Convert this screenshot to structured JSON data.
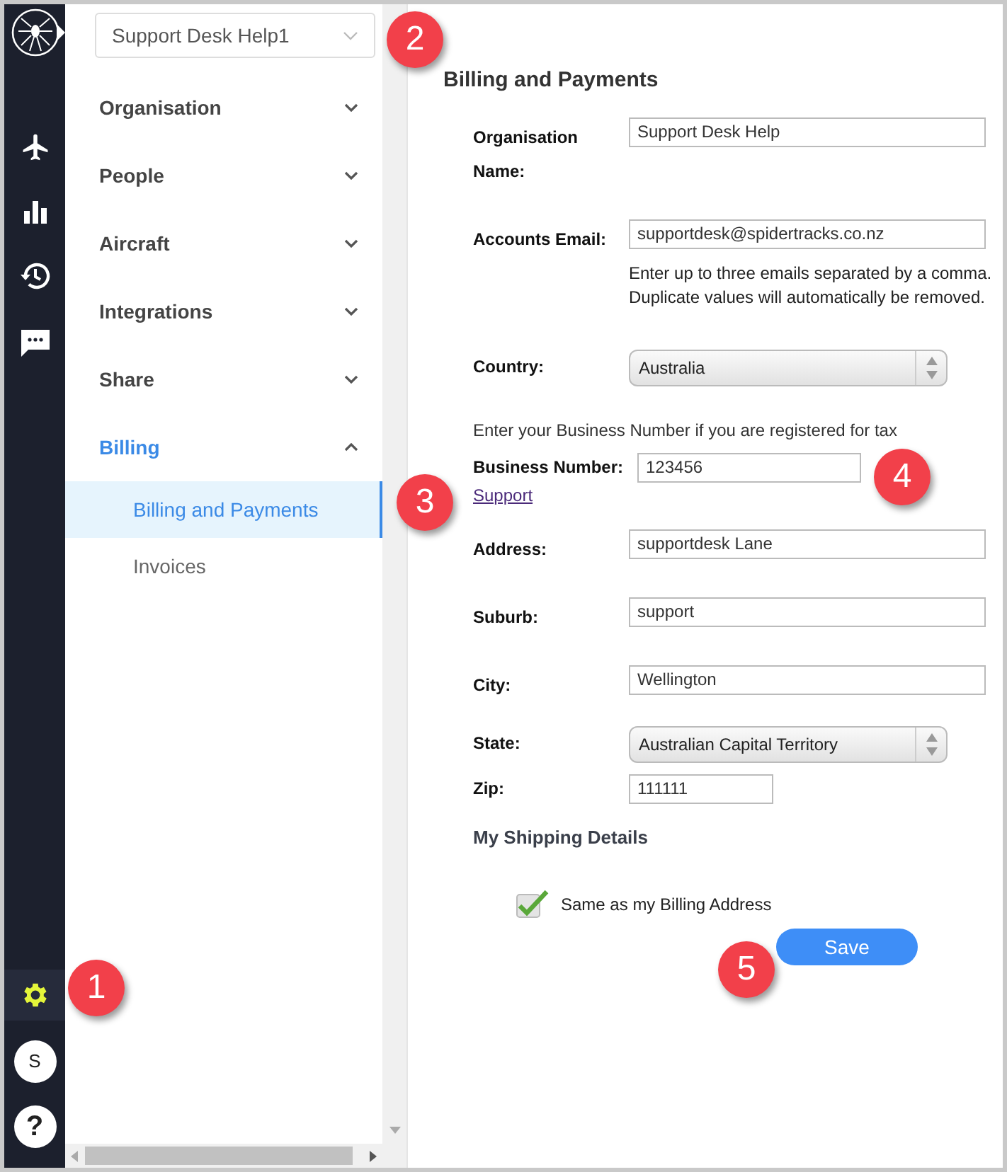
{
  "rail": {
    "items": [
      {
        "kind": "logo",
        "selected": false
      },
      {
        "kind": "plane",
        "selected": false
      },
      {
        "kind": "chart",
        "selected": false
      },
      {
        "kind": "history",
        "selected": false
      },
      {
        "kind": "chat",
        "selected": false
      }
    ],
    "bottom_items": [
      {
        "kind": "settings",
        "selected": true
      },
      {
        "kind": "avatar",
        "text": "S",
        "selected": false
      },
      {
        "kind": "help",
        "text": "?",
        "selected": false
      }
    ]
  },
  "nav": {
    "org_picker": {
      "value": "Support Desk Help1"
    },
    "sections": [
      {
        "label": "Organisation",
        "expanded": false,
        "selected": false
      },
      {
        "label": "People",
        "expanded": false,
        "selected": false
      },
      {
        "label": "Aircraft",
        "expanded": false,
        "selected": false
      },
      {
        "label": "Integrations",
        "expanded": false,
        "selected": false
      },
      {
        "label": "Share",
        "expanded": false,
        "selected": false
      },
      {
        "label": "Billing",
        "expanded": true,
        "selected": true,
        "children": [
          {
            "label": "Billing and Payments",
            "selected": true
          },
          {
            "label": "Invoices",
            "selected": false
          }
        ]
      }
    ]
  },
  "form": {
    "title": "Billing and Payments",
    "fields": [
      {
        "kind": "text",
        "label": "Organisation Name:",
        "value": "Support Desk Help"
      },
      {
        "kind": "text",
        "label": "Accounts Email:",
        "value": "supportdesk@spidertracks.co.nz",
        "hint": [
          "Enter up to three emails separated by a comma.",
          "Duplicate values will automatically be removed."
        ]
      },
      {
        "kind": "select",
        "label": "Country:",
        "value": "Australia"
      },
      {
        "kind": "business",
        "note": "Enter your Business Number if you are registered for tax",
        "label": "Business Number:",
        "value": "123456",
        "link": "Support"
      },
      {
        "kind": "text",
        "label": "Address:",
        "value": "supportdesk Lane"
      },
      {
        "kind": "text",
        "label": "Suburb:",
        "value": "support"
      },
      {
        "kind": "text",
        "label": "City:",
        "value": "Wellington"
      },
      {
        "kind": "select",
        "label": "State:",
        "value": "Australian Capital Territory"
      },
      {
        "kind": "short",
        "label": "Zip:",
        "value": "111111"
      }
    ],
    "shipping": {
      "heading": "My Shipping Details",
      "checkbox": {
        "label": "Same as my Billing Address",
        "checked": true
      }
    },
    "save": "Save"
  },
  "callouts": [
    {
      "number": "1"
    },
    {
      "number": "2"
    },
    {
      "number": "3"
    },
    {
      "number": "4"
    },
    {
      "number": "5"
    }
  ]
}
